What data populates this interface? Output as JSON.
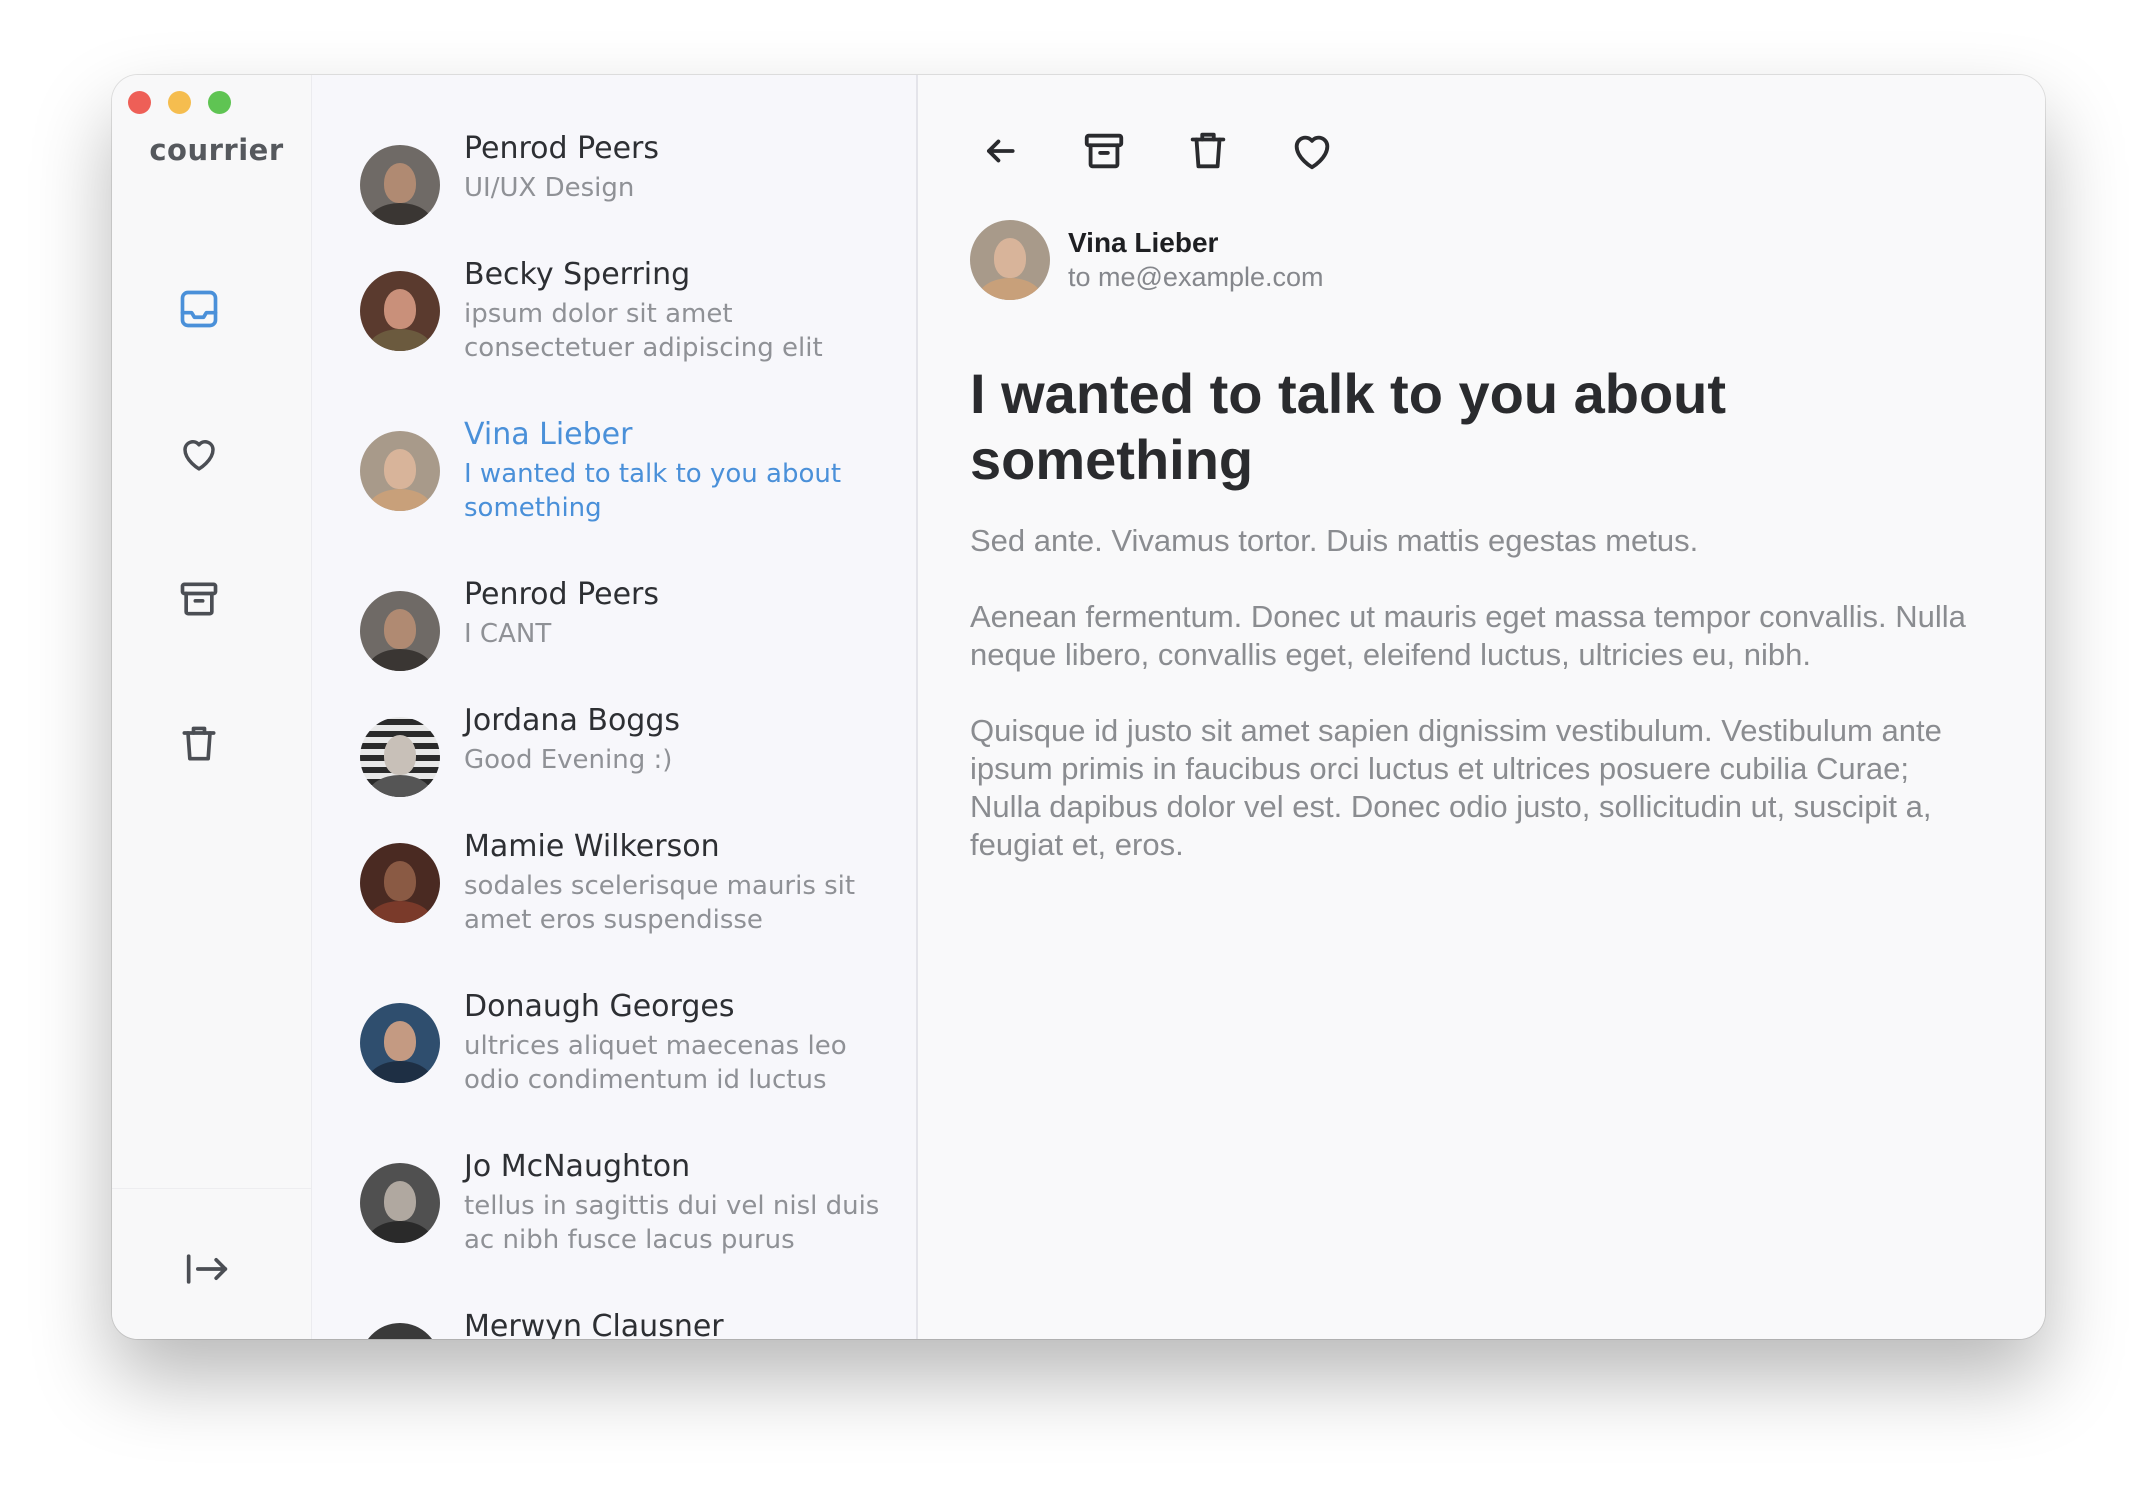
{
  "app": {
    "logo_text": "courrier",
    "traffic_colors": {
      "close": "#ee5f57",
      "minimize": "#f5bd4f",
      "zoom": "#5fc453"
    }
  },
  "colors": {
    "accent": "#4a90d9",
    "icon": "#4b4e54"
  },
  "nav": {
    "items": [
      {
        "name": "inbox-icon",
        "active": true
      },
      {
        "name": "heart-icon"
      },
      {
        "name": "archive-icon"
      },
      {
        "name": "trash-icon"
      }
    ],
    "logout_icon": "logout-icon"
  },
  "messages": [
    {
      "name": "Penrod Peers",
      "preview": "UI/UX Design"
    },
    {
      "name": "Becky Sperring",
      "preview": "ipsum dolor sit amet consectetuer adipiscing elit"
    },
    {
      "name": "Vina Lieber",
      "preview": "I wanted to talk to you about something",
      "active": true
    },
    {
      "name": "Penrod Peers",
      "preview": "I CANT"
    },
    {
      "name": "Jordana Boggs",
      "preview": "Good Evening :)"
    },
    {
      "name": "Mamie Wilkerson",
      "preview": "sodales scelerisque mauris sit amet eros suspendisse"
    },
    {
      "name": "Donaugh Georges",
      "preview": "ultrices aliquet maecenas leo odio condimentum id luctus"
    },
    {
      "name": "Jo McNaughton",
      "preview": "tellus in sagittis dui vel nisl duis ac nibh fusce lacus purus"
    },
    {
      "name": "Merwyn Clausner",
      "preview": ""
    }
  ],
  "reader": {
    "toolbar": [
      "back-arrow-icon",
      "archive-icon",
      "trash-icon",
      "heart-icon"
    ],
    "sender_name": "Vina Lieber",
    "sender_to": "to me@example.com",
    "subject": "I wanted to talk to you about something",
    "paragraphs": [
      "Sed ante. Vivamus tortor. Duis mattis egestas metus.",
      "Aenean fermentum. Donec ut mauris eget massa tempor convallis. Nulla neque libero, convallis eget, eleifend luctus, ultricies eu, nibh.",
      "Quisque id justo sit amet sapien dignissim vestibulum. Vestibulum ante ipsum primis in faucibus orci luctus et ultrices posuere cubilia Curae; Nulla dapibus dolor vel est. Donec odio justo, sollicitudin ut, suscipit a, feugiat et, eros."
    ]
  }
}
